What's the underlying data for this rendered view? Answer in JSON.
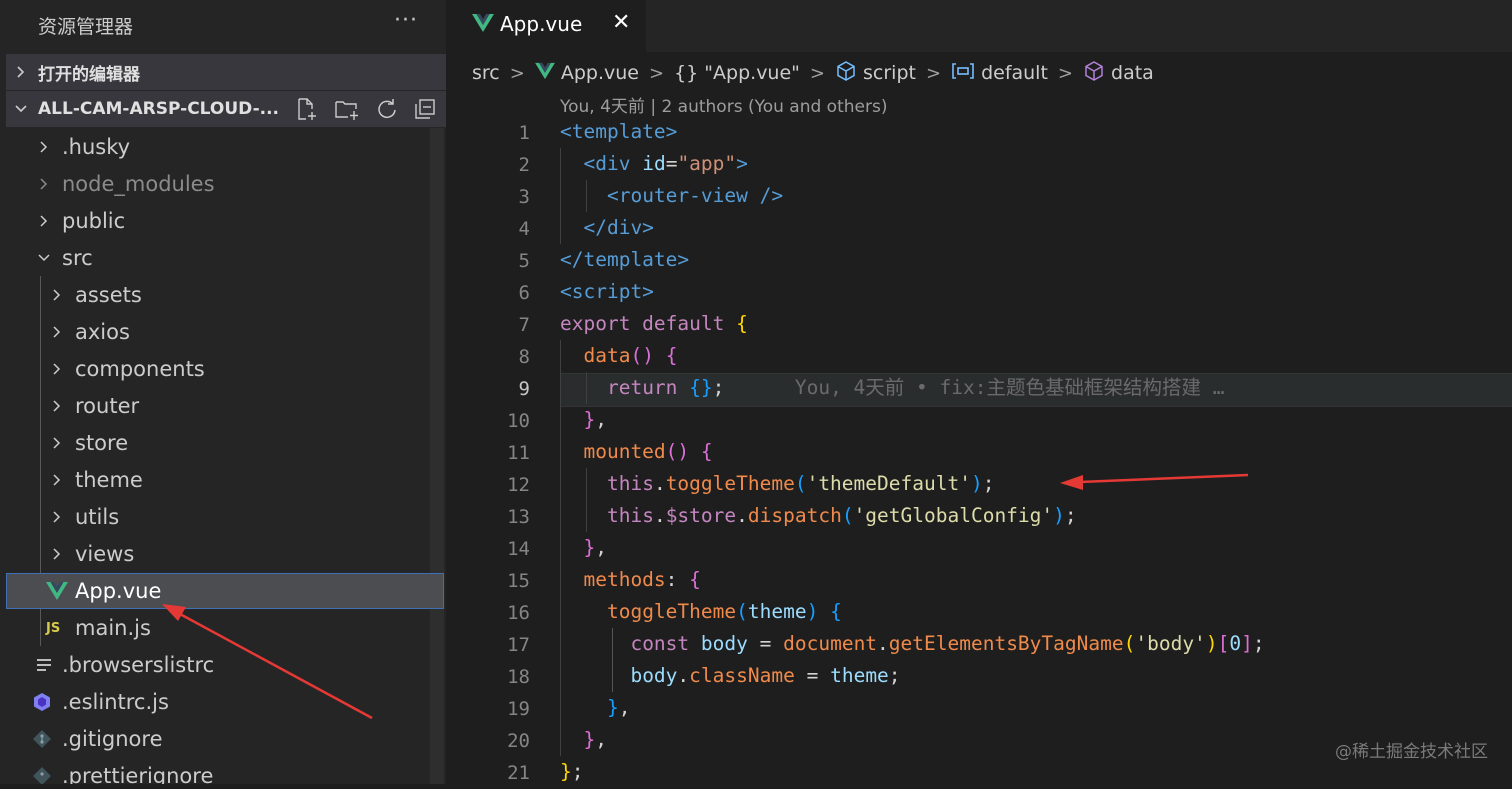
{
  "sidebar": {
    "title": "资源管理器",
    "more_label": "···",
    "open_editors_label": "打开的编辑器",
    "project_label": "ALL-CAM-ARSP-CLOUD-...",
    "tree": [
      {
        "label": ".husky",
        "type": "folder",
        "expanded": false,
        "dim": false
      },
      {
        "label": "node_modules",
        "type": "folder",
        "expanded": false,
        "dim": true
      },
      {
        "label": "public",
        "type": "folder",
        "expanded": false,
        "dim": false
      },
      {
        "label": "src",
        "type": "folder",
        "expanded": true,
        "dim": false
      },
      {
        "label": "assets",
        "type": "folder",
        "expanded": false,
        "dim": false
      },
      {
        "label": "axios",
        "type": "folder",
        "expanded": false,
        "dim": false
      },
      {
        "label": "components",
        "type": "folder",
        "expanded": false,
        "dim": false
      },
      {
        "label": "router",
        "type": "folder",
        "expanded": false,
        "dim": false
      },
      {
        "label": "store",
        "type": "folder",
        "expanded": false,
        "dim": false
      },
      {
        "label": "theme",
        "type": "folder",
        "expanded": false,
        "dim": false
      },
      {
        "label": "utils",
        "type": "folder",
        "expanded": false,
        "dim": false
      },
      {
        "label": "views",
        "type": "folder",
        "expanded": false,
        "dim": false
      },
      {
        "label": "App.vue",
        "type": "vue-file",
        "selected": true
      },
      {
        "label": "main.js",
        "type": "js-file",
        "badge": "JS"
      },
      {
        "label": ".browserslistrc",
        "type": "text-file"
      },
      {
        "label": ".eslintrc.js",
        "type": "eslint-file"
      },
      {
        "label": ".gitignore",
        "type": "git-file"
      },
      {
        "label": ".prettierignore",
        "type": "prettier-file"
      }
    ]
  },
  "editor": {
    "tab": {
      "label": "App.vue",
      "close_label": "✕"
    },
    "breadcrumb": {
      "src": "src",
      "file": "App.vue",
      "obj": "{} \"App.vue\"",
      "script": "script",
      "default": "default",
      "data": "data"
    },
    "codelens": "You, 4天前 | 2 authors (You and others)",
    "blame": "You, 4天前 • fix:主题色基础框架结构搭建 …",
    "line_numbers": [
      "1",
      "2",
      "3",
      "4",
      "5",
      "6",
      "7",
      "8",
      "9",
      "10",
      "11",
      "12",
      "13",
      "14",
      "15",
      "16",
      "17",
      "18",
      "19",
      "20",
      "21"
    ],
    "current_line": 9
  },
  "watermark": "@稀土掘金技术社区",
  "colors": {
    "sidebar_bg": "#252526",
    "editor_bg": "#1e1e1e",
    "selection": "#4b4d51",
    "vue_green": "#41b883",
    "annotation_red": "#e53935"
  }
}
